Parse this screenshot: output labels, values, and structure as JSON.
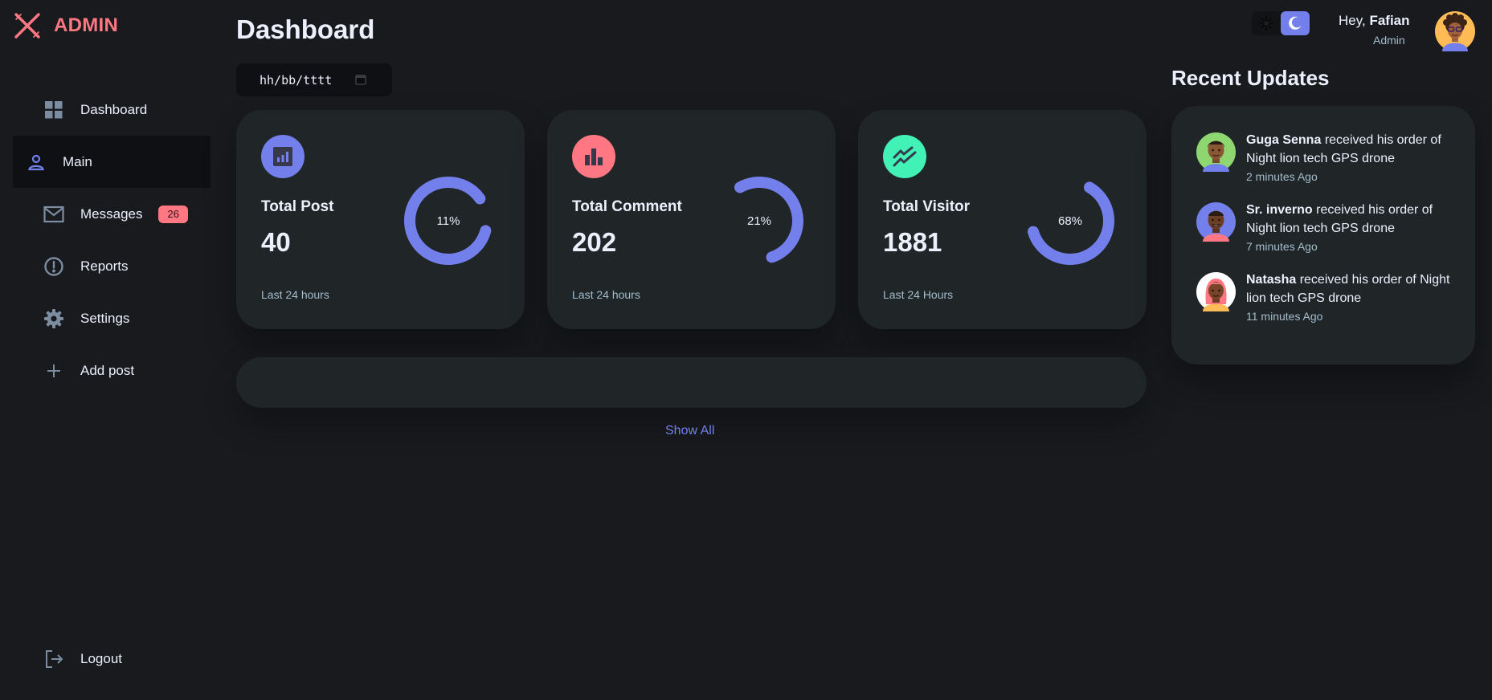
{
  "brand": {
    "name": "ADMIN",
    "accent": "#ff7782",
    "primary": "#7380ec",
    "success": "#41f1b6"
  },
  "sidebar": {
    "items": [
      {
        "label": "Dashboard",
        "icon": "grid-icon"
      },
      {
        "label": "Main",
        "icon": "person-icon",
        "active": true
      },
      {
        "label": "Messages",
        "icon": "mail-icon",
        "badge": "26"
      },
      {
        "label": "Reports",
        "icon": "alert-circle-icon"
      },
      {
        "label": "Settings",
        "icon": "gear-icon"
      },
      {
        "label": "Add post",
        "icon": "plus-icon"
      }
    ],
    "logout": {
      "label": "Logout",
      "icon": "logout-icon"
    }
  },
  "main": {
    "title": "Dashboard",
    "date_placeholder": "hh/bb/tttt",
    "cards": [
      {
        "label": "Total Post",
        "value": "40",
        "percent": "11%",
        "fraction": 0.11,
        "footer": "Last 24 hours",
        "icon": "analytics-icon",
        "color": "#7380ec"
      },
      {
        "label": "Total Comment",
        "value": "202",
        "percent": "21%",
        "fraction": 0.21,
        "footer": "Last 24 hours",
        "icon": "bar-chart-icon",
        "color": "#ff7782"
      },
      {
        "label": "Total Visitor",
        "value": "1881",
        "percent": "68%",
        "fraction": 0.68,
        "footer": "Last 24 Hours",
        "icon": "trend-icon",
        "color": "#41f1b6"
      }
    ],
    "show_all": "Show All"
  },
  "header": {
    "greeting": "Hey,",
    "user_name": "Fafian",
    "role": "Admin",
    "theme": {
      "light_icon": "sun-icon",
      "dark_icon": "moon-icon",
      "selected": "dark"
    }
  },
  "updates": {
    "title": "Recent Updates",
    "items": [
      {
        "name": "Guga Senna",
        "message": "received his order of Night lion tech GPS drone",
        "time": "2 minutes Ago"
      },
      {
        "name": "Sr. inverno",
        "message": "received his order of Night lion tech GPS drone",
        "time": "7 minutes Ago"
      },
      {
        "name": "Natasha",
        "message": "received his order of Night lion tech GPS drone",
        "time": "11 minutes Ago"
      }
    ]
  }
}
